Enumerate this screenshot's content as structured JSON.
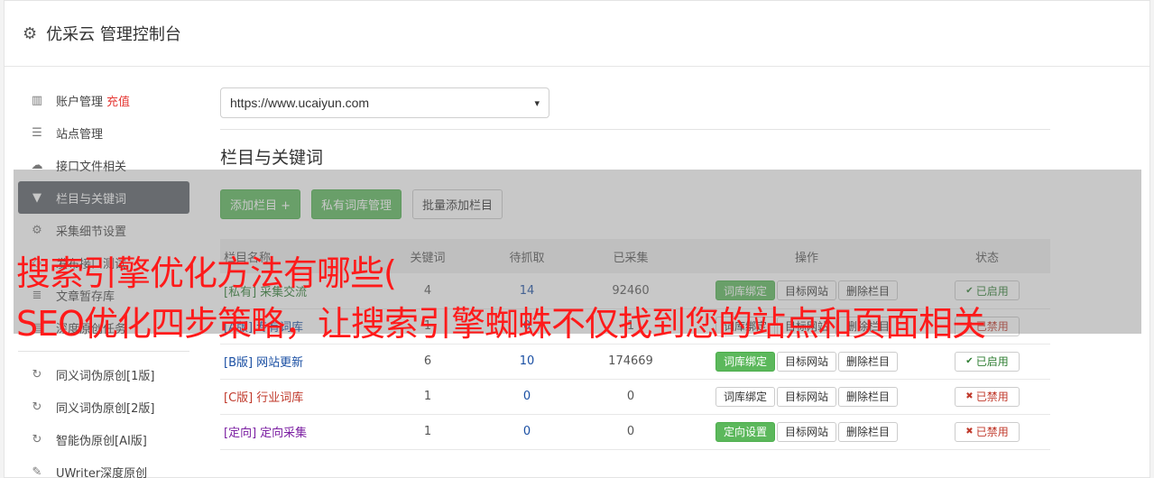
{
  "header": {
    "title": "优采云 管理控制台"
  },
  "sidebar": {
    "items": [
      {
        "label": "账户管理",
        "extra": "充值",
        "icon": "bar-chart-icon",
        "glyph": "▥"
      },
      {
        "label": "站点管理",
        "icon": "server-icon",
        "glyph": "☰"
      },
      {
        "label": "接口文件相关",
        "icon": "cloud-upload-icon",
        "glyph": "☁"
      },
      {
        "label": "栏目与关键词",
        "icon": "filter-icon",
        "glyph": "▼",
        "active": true
      },
      {
        "label": "采集细节设置",
        "icon": "gears-icon",
        "glyph": "⚙"
      },
      {
        "label": "发布接口测试",
        "icon": "test-icon",
        "glyph": "◇"
      },
      {
        "label": "文章暂存库",
        "icon": "database-icon",
        "glyph": "≣"
      },
      {
        "label": "深度原创任务",
        "icon": "document-icon",
        "glyph": "▤"
      }
    ],
    "tools": [
      {
        "label": "同义词伪原创[1版]",
        "icon": "refresh-icon",
        "glyph": "↻"
      },
      {
        "label": "同义词伪原创[2版]",
        "icon": "refresh-icon",
        "glyph": "↻"
      },
      {
        "label": "智能伪原创[AI版]",
        "icon": "refresh-icon",
        "glyph": "↻"
      },
      {
        "label": "UWriter深度原创",
        "icon": "edit-icon",
        "glyph": "✎"
      }
    ]
  },
  "main": {
    "site_select": "https://www.ucaiyun.com",
    "section_title": "栏目与关键词",
    "buttons": {
      "add": "添加栏目 +",
      "private_lib": "私有词库管理",
      "batch_add": "批量添加栏目"
    },
    "table": {
      "headers": [
        "栏目名称",
        "关键词",
        "待抓取",
        "已采集",
        "操作",
        "状态"
      ],
      "rows": [
        {
          "tag": "[私有]",
          "name": "采集交流",
          "kw": "4",
          "pending": "14",
          "collected": "92460",
          "op1": "词库绑定",
          "op1_green": true,
          "op2": "目标网站",
          "op3": "删除栏目",
          "status": "已启用",
          "on": true,
          "cls": "tag-private"
        },
        {
          "tag": "[A版]",
          "name": "专有词库",
          "kw": "1",
          "pending": "0",
          "collected": "1",
          "op1": "词库绑定",
          "op1_green": false,
          "op2": "目标网站",
          "op3": "删除栏目",
          "status": "已禁用",
          "on": false,
          "cls": "tag-a"
        },
        {
          "tag": "[B版]",
          "name": "网站更新",
          "kw": "6",
          "pending": "10",
          "collected": "174669",
          "op1": "词库绑定",
          "op1_green": true,
          "op2": "目标网站",
          "op3": "删除栏目",
          "status": "已启用",
          "on": true,
          "cls": "tag-b"
        },
        {
          "tag": "[C版]",
          "name": "行业词库",
          "kw": "1",
          "pending": "0",
          "collected": "0",
          "op1": "词库绑定",
          "op1_green": false,
          "op2": "目标网站",
          "op3": "删除栏目",
          "status": "已禁用",
          "on": false,
          "cls": "tag-c"
        },
        {
          "tag": "[定向]",
          "name": "定向采集",
          "kw": "1",
          "pending": "0",
          "collected": "0",
          "op1": "定向设置",
          "op1_green": true,
          "op2": "目标网站",
          "op3": "删除栏目",
          "status": "已禁用",
          "on": false,
          "cls": "tag-d"
        }
      ]
    }
  },
  "overlay": {
    "line1": "搜索引擎优化方法有哪些(",
    "line2": "SEO优化四步策略，让搜索引擎蜘蛛不仅找到您的站点和页面相关"
  },
  "colors": {
    "accent_green": "#5cb85c",
    "active_nav": "#5b6067",
    "overlay_text": "#ff1a1a"
  }
}
